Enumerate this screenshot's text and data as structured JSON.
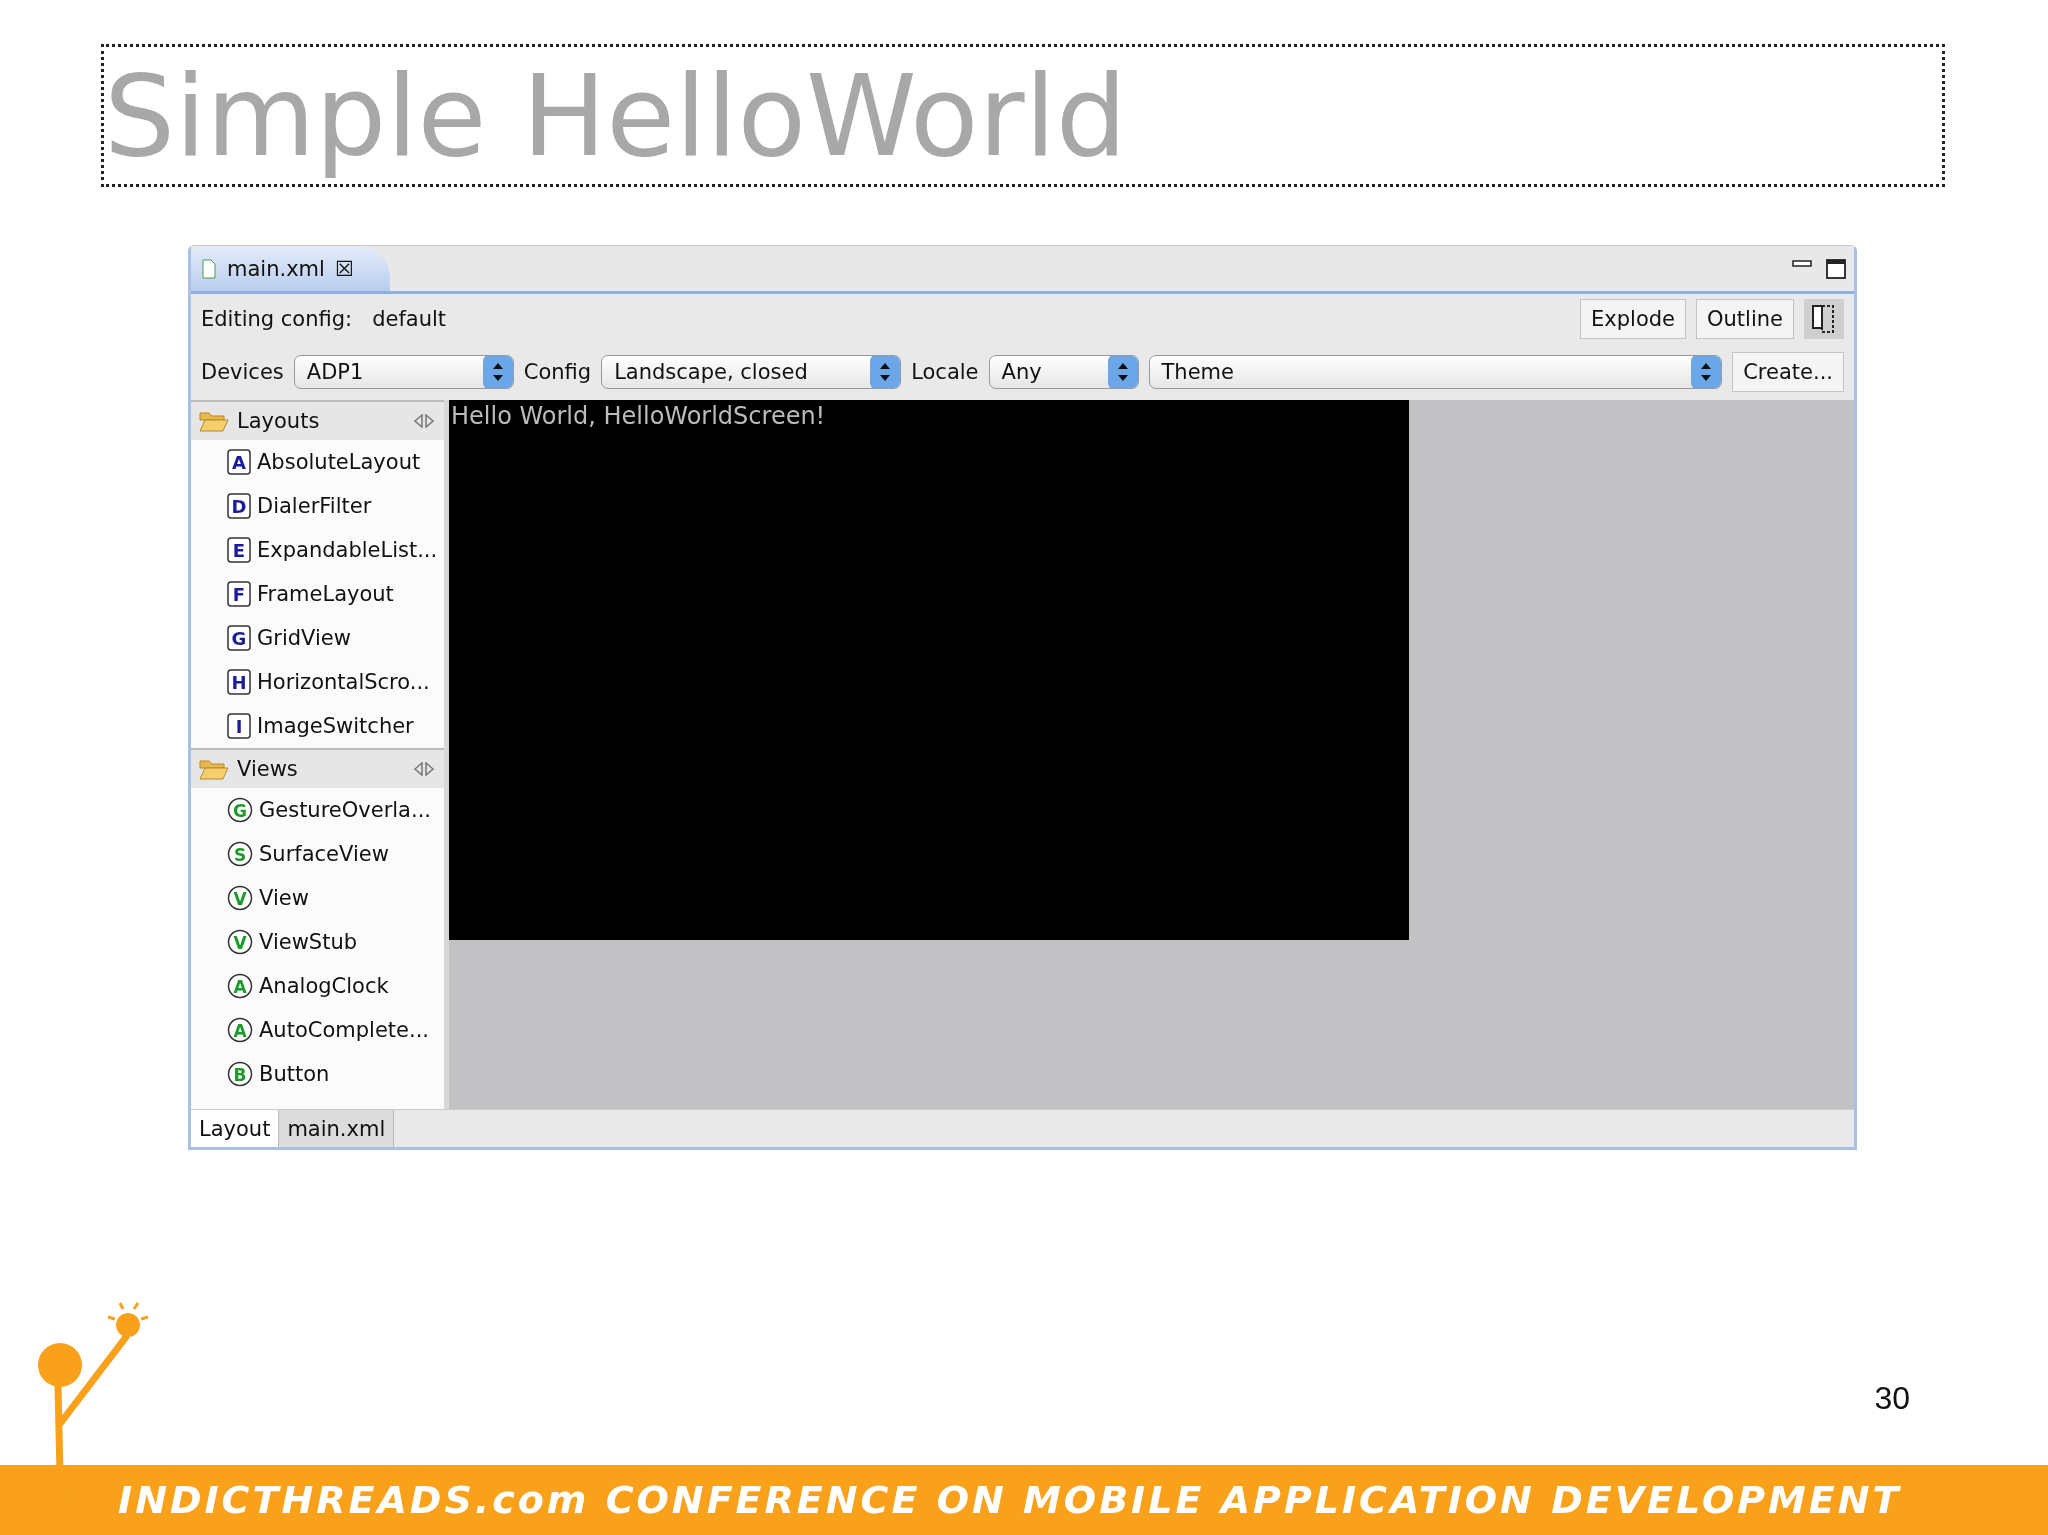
{
  "slide_title": "Simple HelloWorld",
  "editor": {
    "tab": {
      "label": "main.xml",
      "close": "☒"
    },
    "config_label": "Editing config:",
    "config_value": "default",
    "buttons": [
      "Explode",
      "Outline"
    ],
    "selectors": [
      {
        "label": "Devices",
        "value": "ADP1"
      },
      {
        "label": "Config",
        "value": "Landscape, closed"
      },
      {
        "label": "Locale",
        "value": "Any"
      },
      {
        "value": "Theme"
      }
    ],
    "create_button": "Create...",
    "palette": [
      {
        "name": "Layouts",
        "items": [
          {
            "kind": "layout",
            "letter": "A",
            "label": "AbsoluteLayout"
          },
          {
            "kind": "layout",
            "letter": "D",
            "label": "DialerFilter"
          },
          {
            "kind": "layout",
            "letter": "E",
            "label": "ExpandableList..."
          },
          {
            "kind": "layout",
            "letter": "F",
            "label": "FrameLayout"
          },
          {
            "kind": "layout",
            "letter": "G",
            "label": "GridView"
          },
          {
            "kind": "layout",
            "letter": "H",
            "label": "HorizontalScro..."
          },
          {
            "kind": "layout",
            "letter": "I",
            "label": "ImageSwitcher"
          }
        ]
      },
      {
        "name": "Views",
        "items": [
          {
            "kind": "view",
            "letter": "G",
            "label": "GestureOverla..."
          },
          {
            "kind": "view",
            "letter": "S",
            "label": "SurfaceView"
          },
          {
            "kind": "view",
            "letter": "V",
            "label": "View"
          },
          {
            "kind": "view",
            "letter": "V",
            "label": "ViewStub"
          },
          {
            "kind": "view",
            "letter": "A",
            "label": "AnalogClock"
          },
          {
            "kind": "view",
            "letter": "A",
            "label": "AutoComplete..."
          },
          {
            "kind": "view",
            "letter": "B",
            "label": "Button"
          }
        ]
      }
    ],
    "screen_text": "Hello World, HelloWorldScreen!",
    "bottom_tabs": [
      {
        "label": "Layout",
        "selected": true
      },
      {
        "label": "main.xml",
        "selected": false
      }
    ]
  },
  "page_number": "30",
  "footer": "INDICTHREADS.com CONFERENCE ON MOBILE APPLICATION DEVELOPMENT"
}
